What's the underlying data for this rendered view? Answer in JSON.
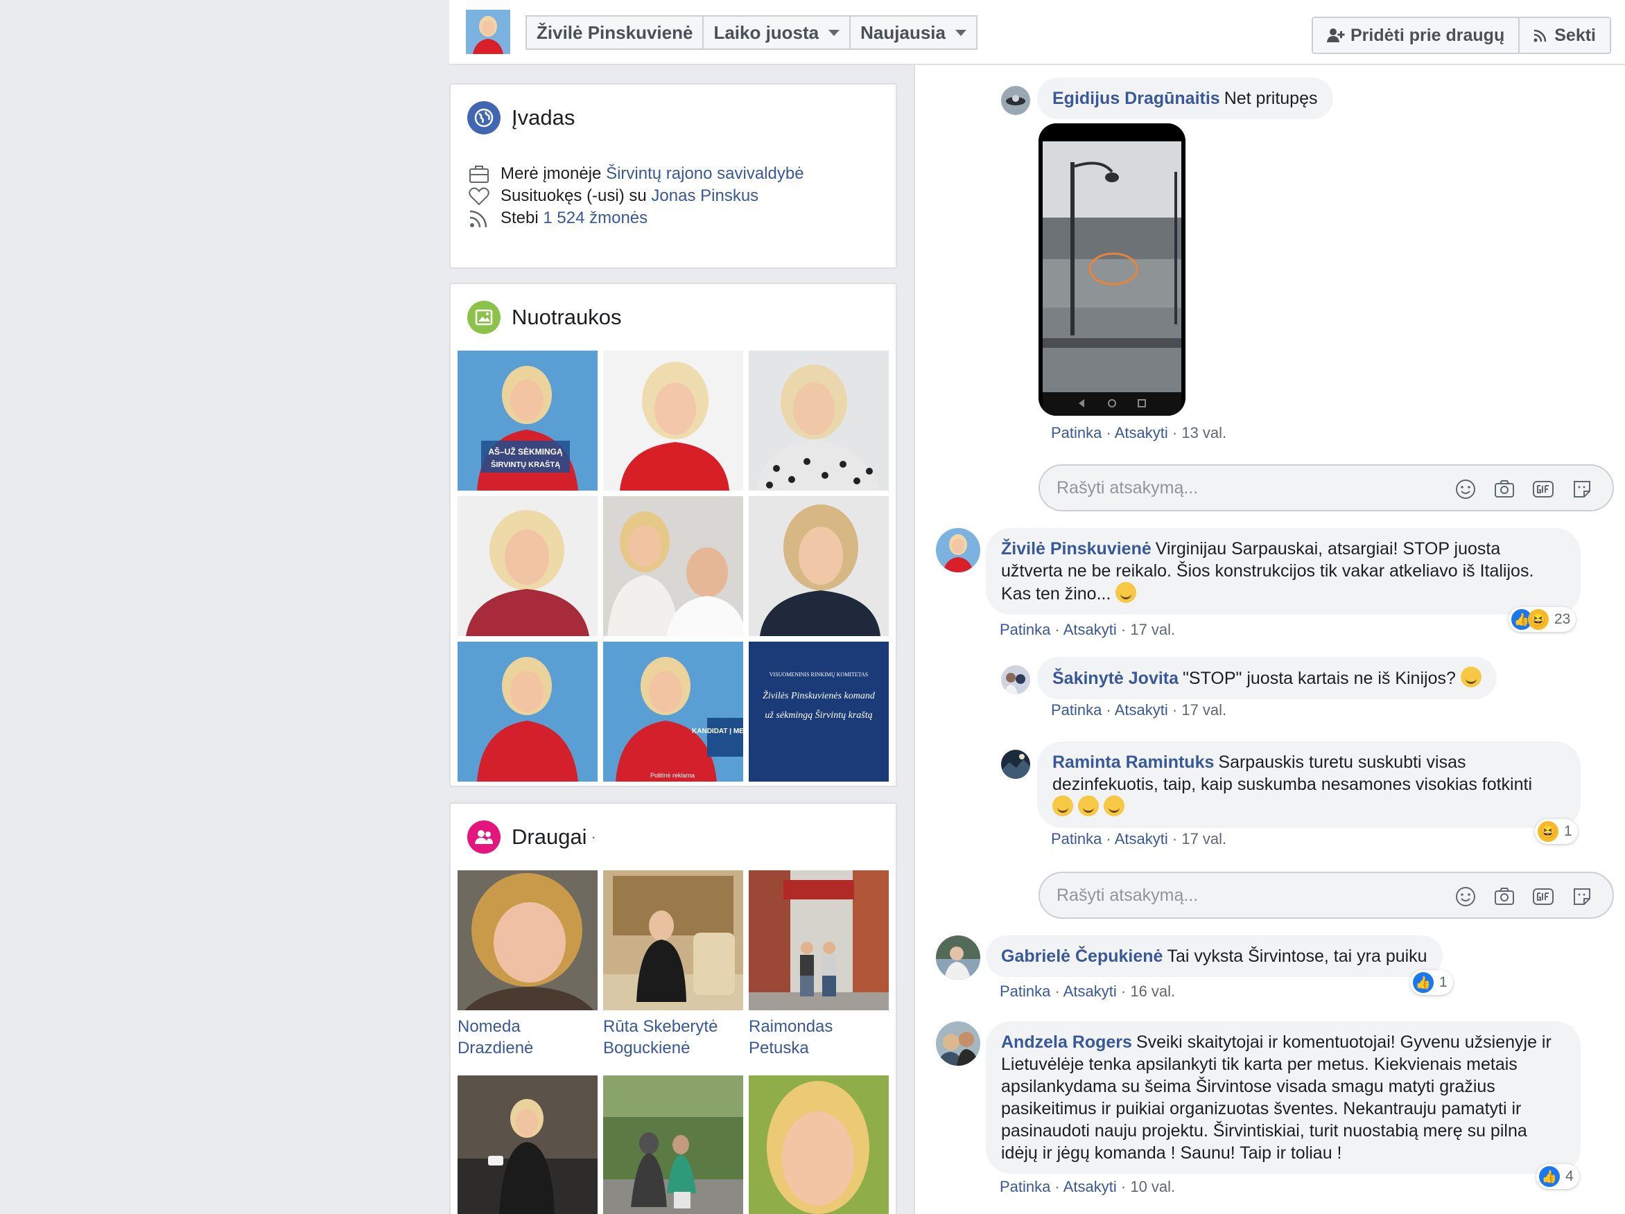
{
  "topbar": {
    "profile_name": "Živilė Pinskuvienė",
    "timeline_label": "Laiko juosta",
    "sort_label": "Naujausia",
    "add_friend_label": "Pridėti prie draugų",
    "follow_label": "Sekti"
  },
  "intro": {
    "title": "Įvadas",
    "work_prefix": "Merė įmonėje",
    "work_link": "Širvintų rajono savivaldybė",
    "relationship_prefix": "Susituokęs (-usi) su",
    "relationship_link": "Jonas Pinskus",
    "followers_prefix": "Stebi",
    "followers_link": "1 524 žmonės"
  },
  "photos": {
    "title": "Nuotraukos",
    "tile1_caption_line1": "AŠ–UŽ SĖKMINGĄ",
    "tile1_caption_line2": "ŠIRVINTŲ KRAŠTĄ",
    "tile8_caption": "KANDIDAT Į MERUS",
    "tile8_footer": "Politinė reklama",
    "tile9_header": "VISUOMENINIS RINKIMŲ KOMITETAS",
    "tile9_line1": "Živilės Pinskuvienės komand",
    "tile9_line2": "už sėkmingą Širvintų kraštą"
  },
  "friends": {
    "title": "Draugai",
    "title_suffix": "·",
    "items": [
      {
        "line1": "Nomeda",
        "line2": "Drazdienė"
      },
      {
        "line1": "Rūta Skeberytė",
        "line2": "Boguckienė"
      },
      {
        "line1": "Raimondas",
        "line2": "Petuska"
      }
    ]
  },
  "comments": {
    "c1": {
      "author": "Egidijus Dragūnaitis",
      "text": "Net pritupęs",
      "like": "Patinka",
      "reply": "Atsakyti",
      "time": "13 val."
    },
    "reply_placeholder": "Rašyti atsakymą...",
    "c2": {
      "author": "Živilė Pinskuvienė",
      "text": "Virginijau Sarpauskai, atsargiai! STOP juosta užtverta ne be reikalo. Šios konstrukcijos tik vakar atkeliavo iš Italijos. Kas ten žino...",
      "like": "Patinka",
      "reply": "Atsakyti",
      "time": "17 val.",
      "reactions": "23"
    },
    "c3": {
      "author": "Šakinytė Jovita",
      "text": "\"STOP\" juosta kartais ne iš Kinijos?",
      "like": "Patinka",
      "reply": "Atsakyti",
      "time": "17 val."
    },
    "c4": {
      "author": "Raminta Ramintuks",
      "text": "Sarpauskis turetu suskubti visas dezinfekuotis, taip, kaip suskumba nesamones visokias fotkinti",
      "like": "Patinka",
      "reply": "Atsakyti",
      "time": "17 val.",
      "reactions": "1"
    },
    "c5": {
      "author": "Gabrielė Čepukienė",
      "text": "Tai vyksta Širvintose, tai yra puiku",
      "like": "Patinka",
      "reply": "Atsakyti",
      "time": "16 val.",
      "reactions": "1"
    },
    "c6": {
      "author": "Andzela Rogers",
      "text": "Sveiki skaitytojai ir komentuotojai! Gyvenu užsienyje ir Lietuvėlėje tenka apsilankyti tik karta per metus. Kiekvienais metais apsilankydama su šeima Širvintose visada smagu matyti gražius pasikeitimus ir puikiai organizuotas šventes. Nekantrauju pamatyti ir pasinaudoti nauju projektu. Širvintiskiai, turit nuostabią merę su pilna idėjų ir jėgų komanda ! Saunu! Taip ir toliau !",
      "like": "Patinka",
      "reply": "Atsakyti",
      "time": "10 val.",
      "reactions": "4"
    }
  },
  "colors": {
    "link": "#385898",
    "bubble": "#f2f3f5",
    "like_blue": "#1877f2",
    "page_bg": "#e9ebee"
  }
}
